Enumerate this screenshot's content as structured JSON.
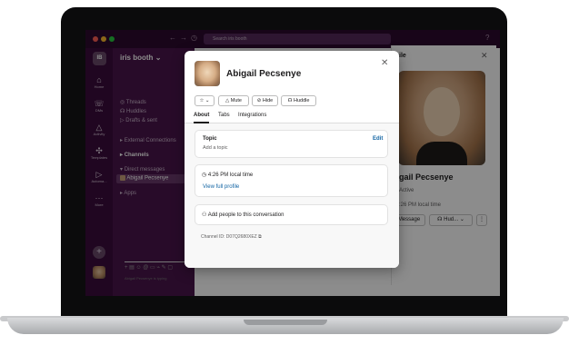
{
  "topbar": {
    "search_placeholder": "Search iris booth"
  },
  "workspace": {
    "initials": "IB",
    "name": "iris booth"
  },
  "rail": {
    "items": [
      {
        "label": "Home",
        "icon": "home-icon"
      },
      {
        "label": "DMs",
        "icon": "dm-icon"
      },
      {
        "label": "Activity",
        "icon": "bell-icon"
      },
      {
        "label": "Templates",
        "icon": "templates-icon"
      },
      {
        "label": "Automa...",
        "icon": "automation-icon"
      },
      {
        "label": "More",
        "icon": "more-icon"
      }
    ]
  },
  "sidebar": {
    "items": [
      {
        "label": "Threads"
      },
      {
        "label": "Huddles"
      },
      {
        "label": "Drafts & sent"
      },
      {
        "label": "External Connections"
      },
      {
        "label": "Channels"
      },
      {
        "label": "Direct messages"
      },
      {
        "label": "Abigail Pecsenye"
      },
      {
        "label": "Apps"
      }
    ]
  },
  "panel": {
    "title": "ile",
    "name": "gail Pecsenye",
    "status": "Active",
    "local_time": ":26 PM local time",
    "message_label": "Message",
    "huddle_label": "Hud..."
  },
  "composer": {
    "typing": "Abigail Pecsenye is typing"
  },
  "modal": {
    "name": "Abigail Pecsenye",
    "buttons": {
      "star": "☆",
      "mute": "Mute",
      "hide": "Hide",
      "huddle": "Huddle"
    },
    "tabs": [
      "About",
      "Tabs",
      "Integrations"
    ],
    "topic": {
      "label": "Topic",
      "edit": "Edit",
      "placeholder": "Add a topic"
    },
    "time": {
      "local_time": "4:26 PM local time",
      "view_profile": "View full profile"
    },
    "add_people": "Add people to this conversation",
    "channel_id": "Channel ID: D07Q2680XEZ"
  },
  "colors": {
    "aubergine": "#4a154b",
    "link": "#1264a3"
  }
}
